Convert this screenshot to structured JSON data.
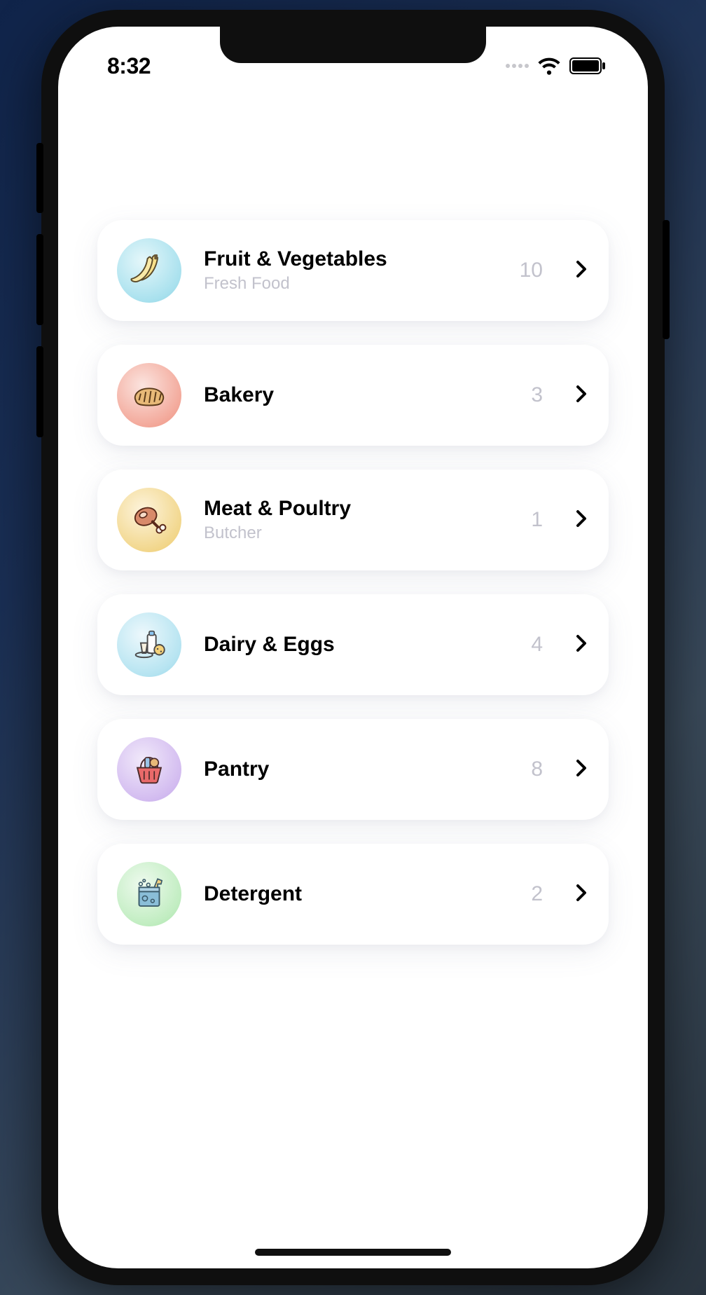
{
  "status_bar": {
    "time": "8:32"
  },
  "categories": [
    {
      "id": "fruit-veg",
      "title": "Fruit & Vegetables",
      "subtitle": "Fresh Food",
      "count": "10",
      "icon": "banana-icon",
      "circle_gradient": "radial-gradient(circle at 40% 35%, #e5f7fa 0%, #a9e1ee 70%, #8ad2e1 100%)"
    },
    {
      "id": "bakery",
      "title": "Bakery",
      "subtitle": "",
      "count": "3",
      "icon": "bread-icon",
      "circle_gradient": "radial-gradient(circle at 40% 35%, #fbe4df 0%, #f3a99b 70%, #ee8f7c 100%)"
    },
    {
      "id": "meat",
      "title": "Meat & Poultry",
      "subtitle": "Butcher",
      "count": "1",
      "icon": "meat-icon",
      "circle_gradient": "radial-gradient(circle at 40% 35%, #fdf4dd 0%, #f2d78d 70%, #edc96a 100%)"
    },
    {
      "id": "dairy",
      "title": "Dairy & Eggs",
      "subtitle": "",
      "count": "4",
      "icon": "dairy-icon",
      "circle_gradient": "radial-gradient(circle at 40% 35%, #edf8fc 0%, #b6e4f1 70%, #94d6e8 100%)"
    },
    {
      "id": "pantry",
      "title": "Pantry",
      "subtitle": "",
      "count": "8",
      "icon": "basket-icon",
      "circle_gradient": "radial-gradient(circle at 40% 35%, #f1e9fa 0%, #d3bcf0 70%, #c2a7e9 100%)"
    },
    {
      "id": "detergent",
      "title": "Detergent",
      "subtitle": "",
      "count": "2",
      "icon": "detergent-icon",
      "circle_gradient": "radial-gradient(circle at 40% 35%, #eefaee 0%, #c1edc1 70%, #a7e3a8 100%)"
    }
  ]
}
